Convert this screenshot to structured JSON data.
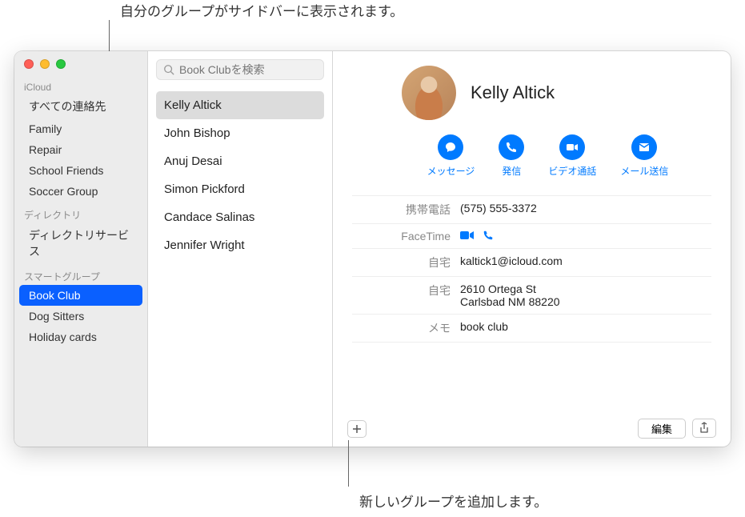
{
  "callouts": {
    "top": "自分のグループがサイドバーに表示されます。",
    "bottom": "新しいグループを追加します。"
  },
  "sidebar": {
    "sections": [
      {
        "label": "iCloud",
        "items": [
          {
            "label": "すべての連絡先",
            "selected": false
          },
          {
            "label": "Family",
            "selected": false
          },
          {
            "label": "Repair",
            "selected": false
          },
          {
            "label": "School Friends",
            "selected": false
          },
          {
            "label": "Soccer Group",
            "selected": false
          }
        ]
      },
      {
        "label": "ディレクトリ",
        "items": [
          {
            "label": "ディレクトリサービス",
            "selected": false
          }
        ]
      },
      {
        "label": "スマートグループ",
        "items": [
          {
            "label": "Book Club",
            "selected": true
          },
          {
            "label": "Dog Sitters",
            "selected": false
          },
          {
            "label": "Holiday cards",
            "selected": false
          }
        ]
      }
    ]
  },
  "search": {
    "placeholder": "Book Clubを検索"
  },
  "contacts": [
    {
      "name": "Kelly Altick",
      "selected": true
    },
    {
      "name": "John Bishop",
      "selected": false
    },
    {
      "name": "Anuj Desai",
      "selected": false
    },
    {
      "name": "Simon Pickford",
      "selected": false
    },
    {
      "name": "Candace Salinas",
      "selected": false
    },
    {
      "name": "Jennifer Wright",
      "selected": false
    }
  ],
  "detail": {
    "name": "Kelly Altick",
    "actions": {
      "message": "メッセージ",
      "call": "発信",
      "video": "ビデオ通話",
      "mail": "メール送信"
    },
    "fields": [
      {
        "label": "携帯電話",
        "value": "(575) 555-3372",
        "type": "text"
      },
      {
        "label": "FaceTime",
        "value": "",
        "type": "facetime"
      },
      {
        "label": "自宅",
        "value": "kaltick1@icloud.com",
        "type": "text"
      },
      {
        "label": "自宅",
        "value": "2610 Ortega St\nCarlsbad NM 88220",
        "type": "multiline"
      },
      {
        "label": "メモ",
        "value": "book club",
        "type": "text"
      }
    ]
  },
  "buttons": {
    "edit": "編集"
  }
}
